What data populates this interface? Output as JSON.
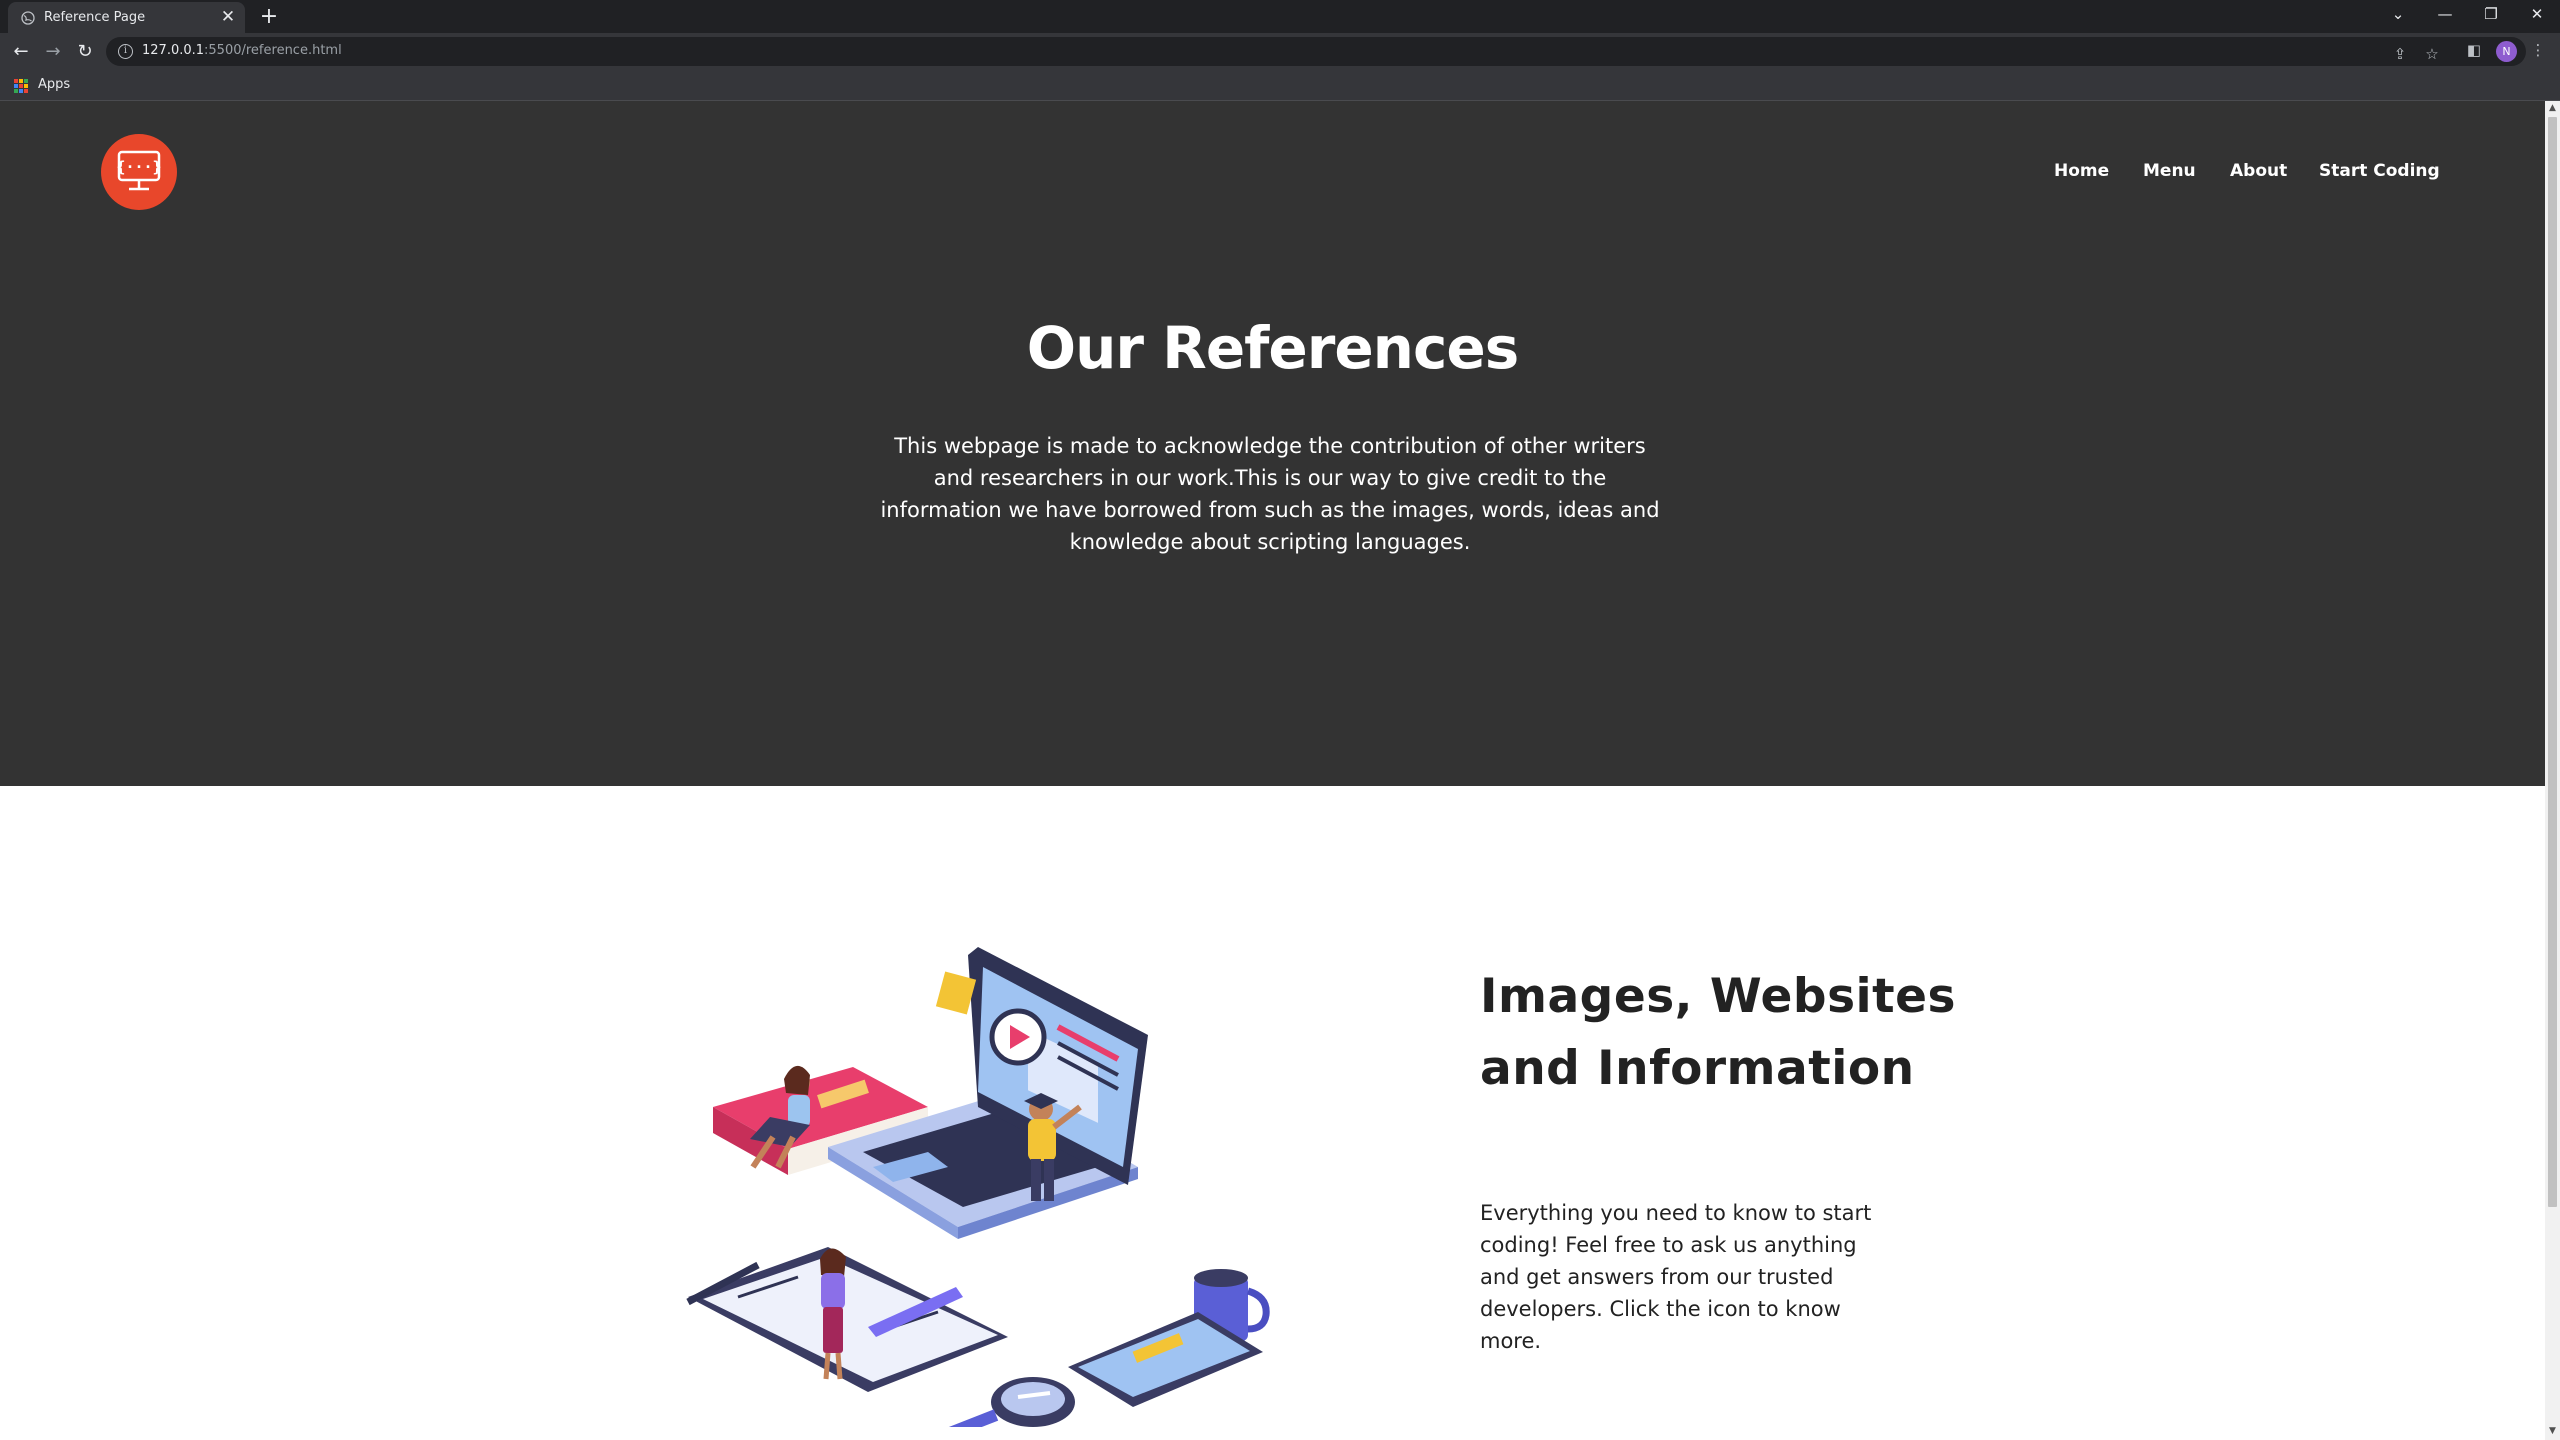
{
  "browser": {
    "tab_title": "Reference Page",
    "tab_close": "✕",
    "new_tab": "+",
    "url_host": "127.0.0.1",
    "url_rest": ":5500/reference.html",
    "profile_initial": "N",
    "bookmarks_apps_label": "Apps",
    "window_controls": [
      "⌄",
      "—",
      "❐",
      "✕"
    ],
    "nav_icons": [
      "back-icon",
      "forward-icon",
      "reload-icon"
    ],
    "toolbar_icons": [
      "share-icon",
      "star-icon",
      "sidebar-icon",
      "menu-icon"
    ]
  },
  "site": {
    "brand_color": "#e8472b",
    "hero_bg": "#333333",
    "nav": {
      "home": "Home",
      "menu": "Menu",
      "about": "About",
      "start": "Start Coding"
    },
    "hero": {
      "title": "Our References",
      "text": "This webpage is made to acknowledge the contribution of other writers and researchers in our work.This is our way to give credit to the information we have borrowed from such as the images, words, ideas and knowledge about scripting languages."
    },
    "section": {
      "title": "Images, Websites and Information",
      "text": "Everything you need to know to start coding! Feel free to ask us anything and get answers from our trusted developers. Click the icon to know more."
    }
  }
}
